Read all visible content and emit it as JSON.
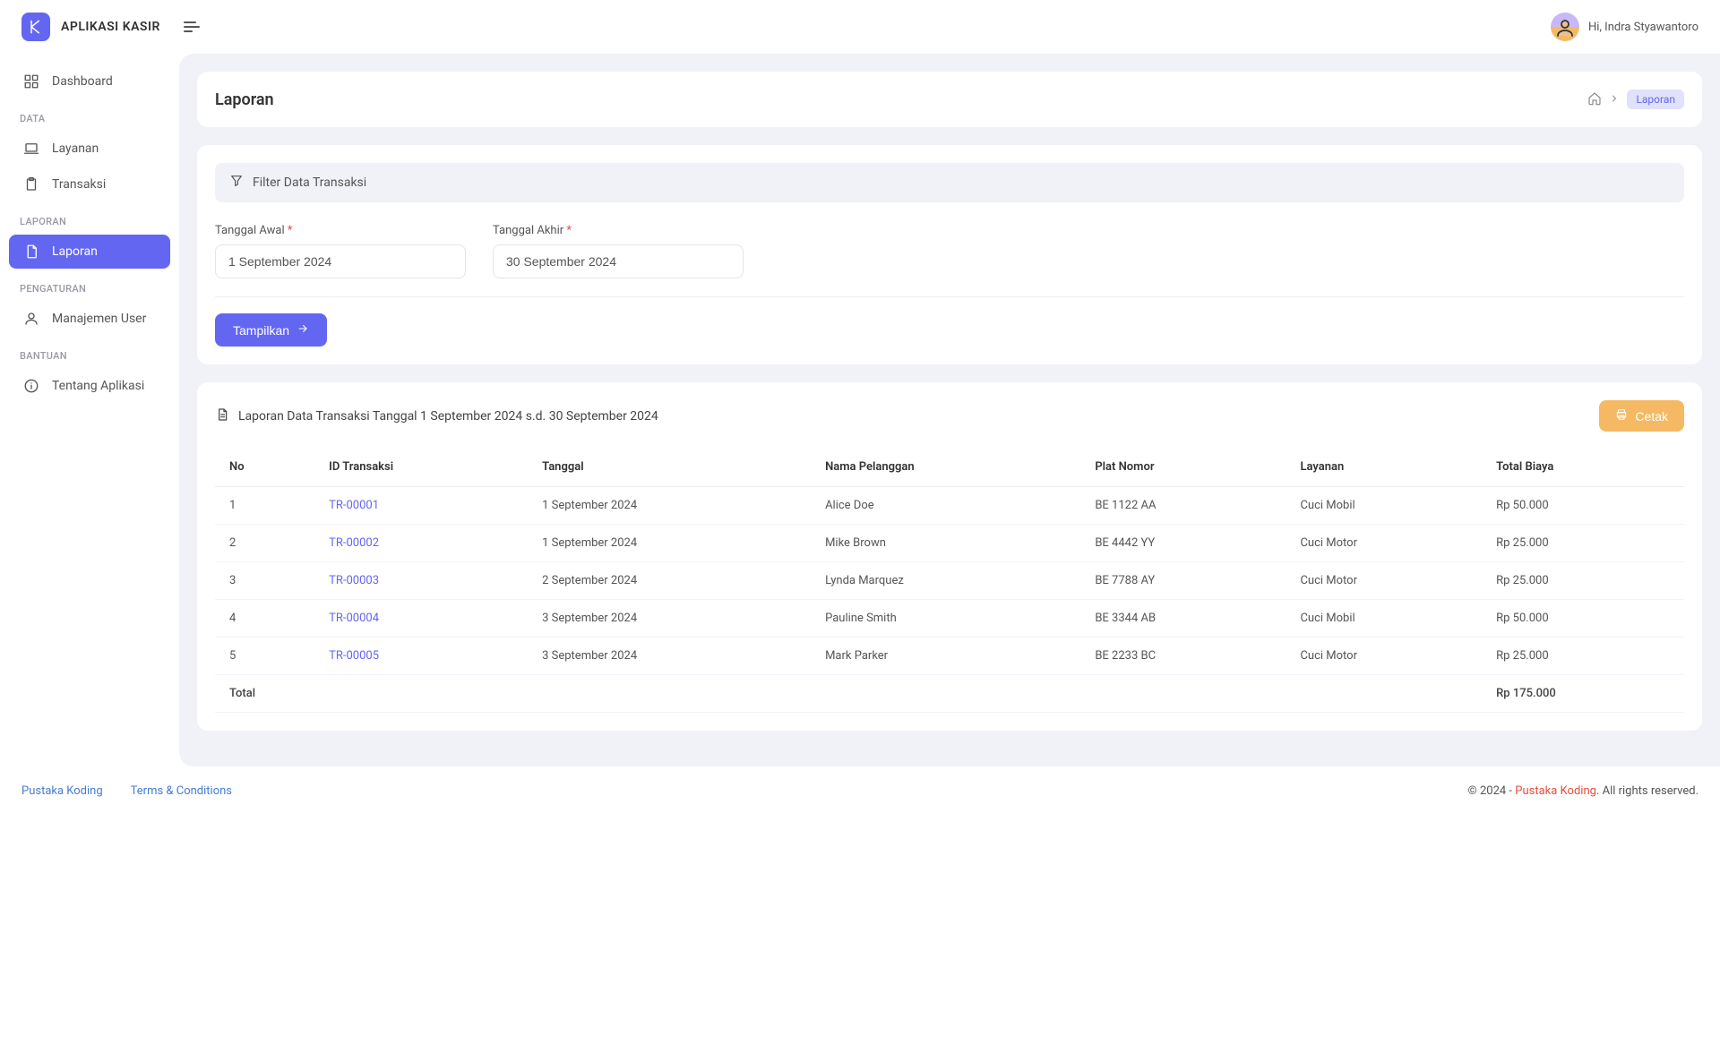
{
  "app": {
    "name": "APLIKASI KASIR"
  },
  "user": {
    "greeting": "Hi, Indra Styawantoro"
  },
  "sidebar": {
    "items": [
      {
        "label": "Dashboard"
      }
    ],
    "sections": [
      {
        "title": "DATA",
        "items": [
          {
            "label": "Layanan"
          },
          {
            "label": "Transaksi"
          }
        ]
      },
      {
        "title": "LAPORAN",
        "items": [
          {
            "label": "Laporan"
          }
        ]
      },
      {
        "title": "PENGATURAN",
        "items": [
          {
            "label": "Manajemen User"
          }
        ]
      },
      {
        "title": "BANTUAN",
        "items": [
          {
            "label": "Tentang Aplikasi"
          }
        ]
      }
    ]
  },
  "page": {
    "title": "Laporan",
    "breadcrumb_current": "Laporan"
  },
  "filter": {
    "header": "Filter Data Transaksi",
    "start_label": "Tanggal Awal",
    "end_label": "Tanggal Akhir",
    "required_mark": "*",
    "start_value": "1 September 2024",
    "end_value": "30 September 2024",
    "submit_label": "Tampilkan"
  },
  "report": {
    "title": "Laporan Data Transaksi Tanggal 1 September 2024 s.d. 30 September 2024",
    "print_label": "Cetak",
    "columns": {
      "no": "No",
      "id": "ID Transaksi",
      "tanggal": "Tanggal",
      "nama": "Nama Pelanggan",
      "plat": "Plat Nomor",
      "layanan": "Layanan",
      "total": "Total Biaya"
    },
    "rows": [
      {
        "no": "1",
        "id": "TR-00001",
        "tanggal": "1 September 2024",
        "nama": "Alice Doe",
        "plat": "BE 1122 AA",
        "layanan": "Cuci Mobil",
        "total": "Rp 50.000"
      },
      {
        "no": "2",
        "id": "TR-00002",
        "tanggal": "1 September 2024",
        "nama": "Mike Brown",
        "plat": "BE 4442 YY",
        "layanan": "Cuci Motor",
        "total": "Rp 25.000"
      },
      {
        "no": "3",
        "id": "TR-00003",
        "tanggal": "2 September 2024",
        "nama": "Lynda Marquez",
        "plat": "BE 7788 AY",
        "layanan": "Cuci Motor",
        "total": "Rp 25.000"
      },
      {
        "no": "4",
        "id": "TR-00004",
        "tanggal": "3 September 2024",
        "nama": "Pauline Smith",
        "plat": "BE 3344 AB",
        "layanan": "Cuci Mobil",
        "total": "Rp 50.000"
      },
      {
        "no": "5",
        "id": "TR-00005",
        "tanggal": "3 September 2024",
        "nama": "Mark Parker",
        "plat": "BE 2233 BC",
        "layanan": "Cuci Motor",
        "total": "Rp 25.000"
      }
    ],
    "total_label": "Total",
    "total_value": "Rp 175.000"
  },
  "footer": {
    "link1": "Pustaka Koding",
    "link2": "Terms & Conditions",
    "copyright_prefix": "© 2024 - ",
    "copyright_brand": "Pustaka Koding",
    "copyright_suffix": ". All rights reserved."
  }
}
